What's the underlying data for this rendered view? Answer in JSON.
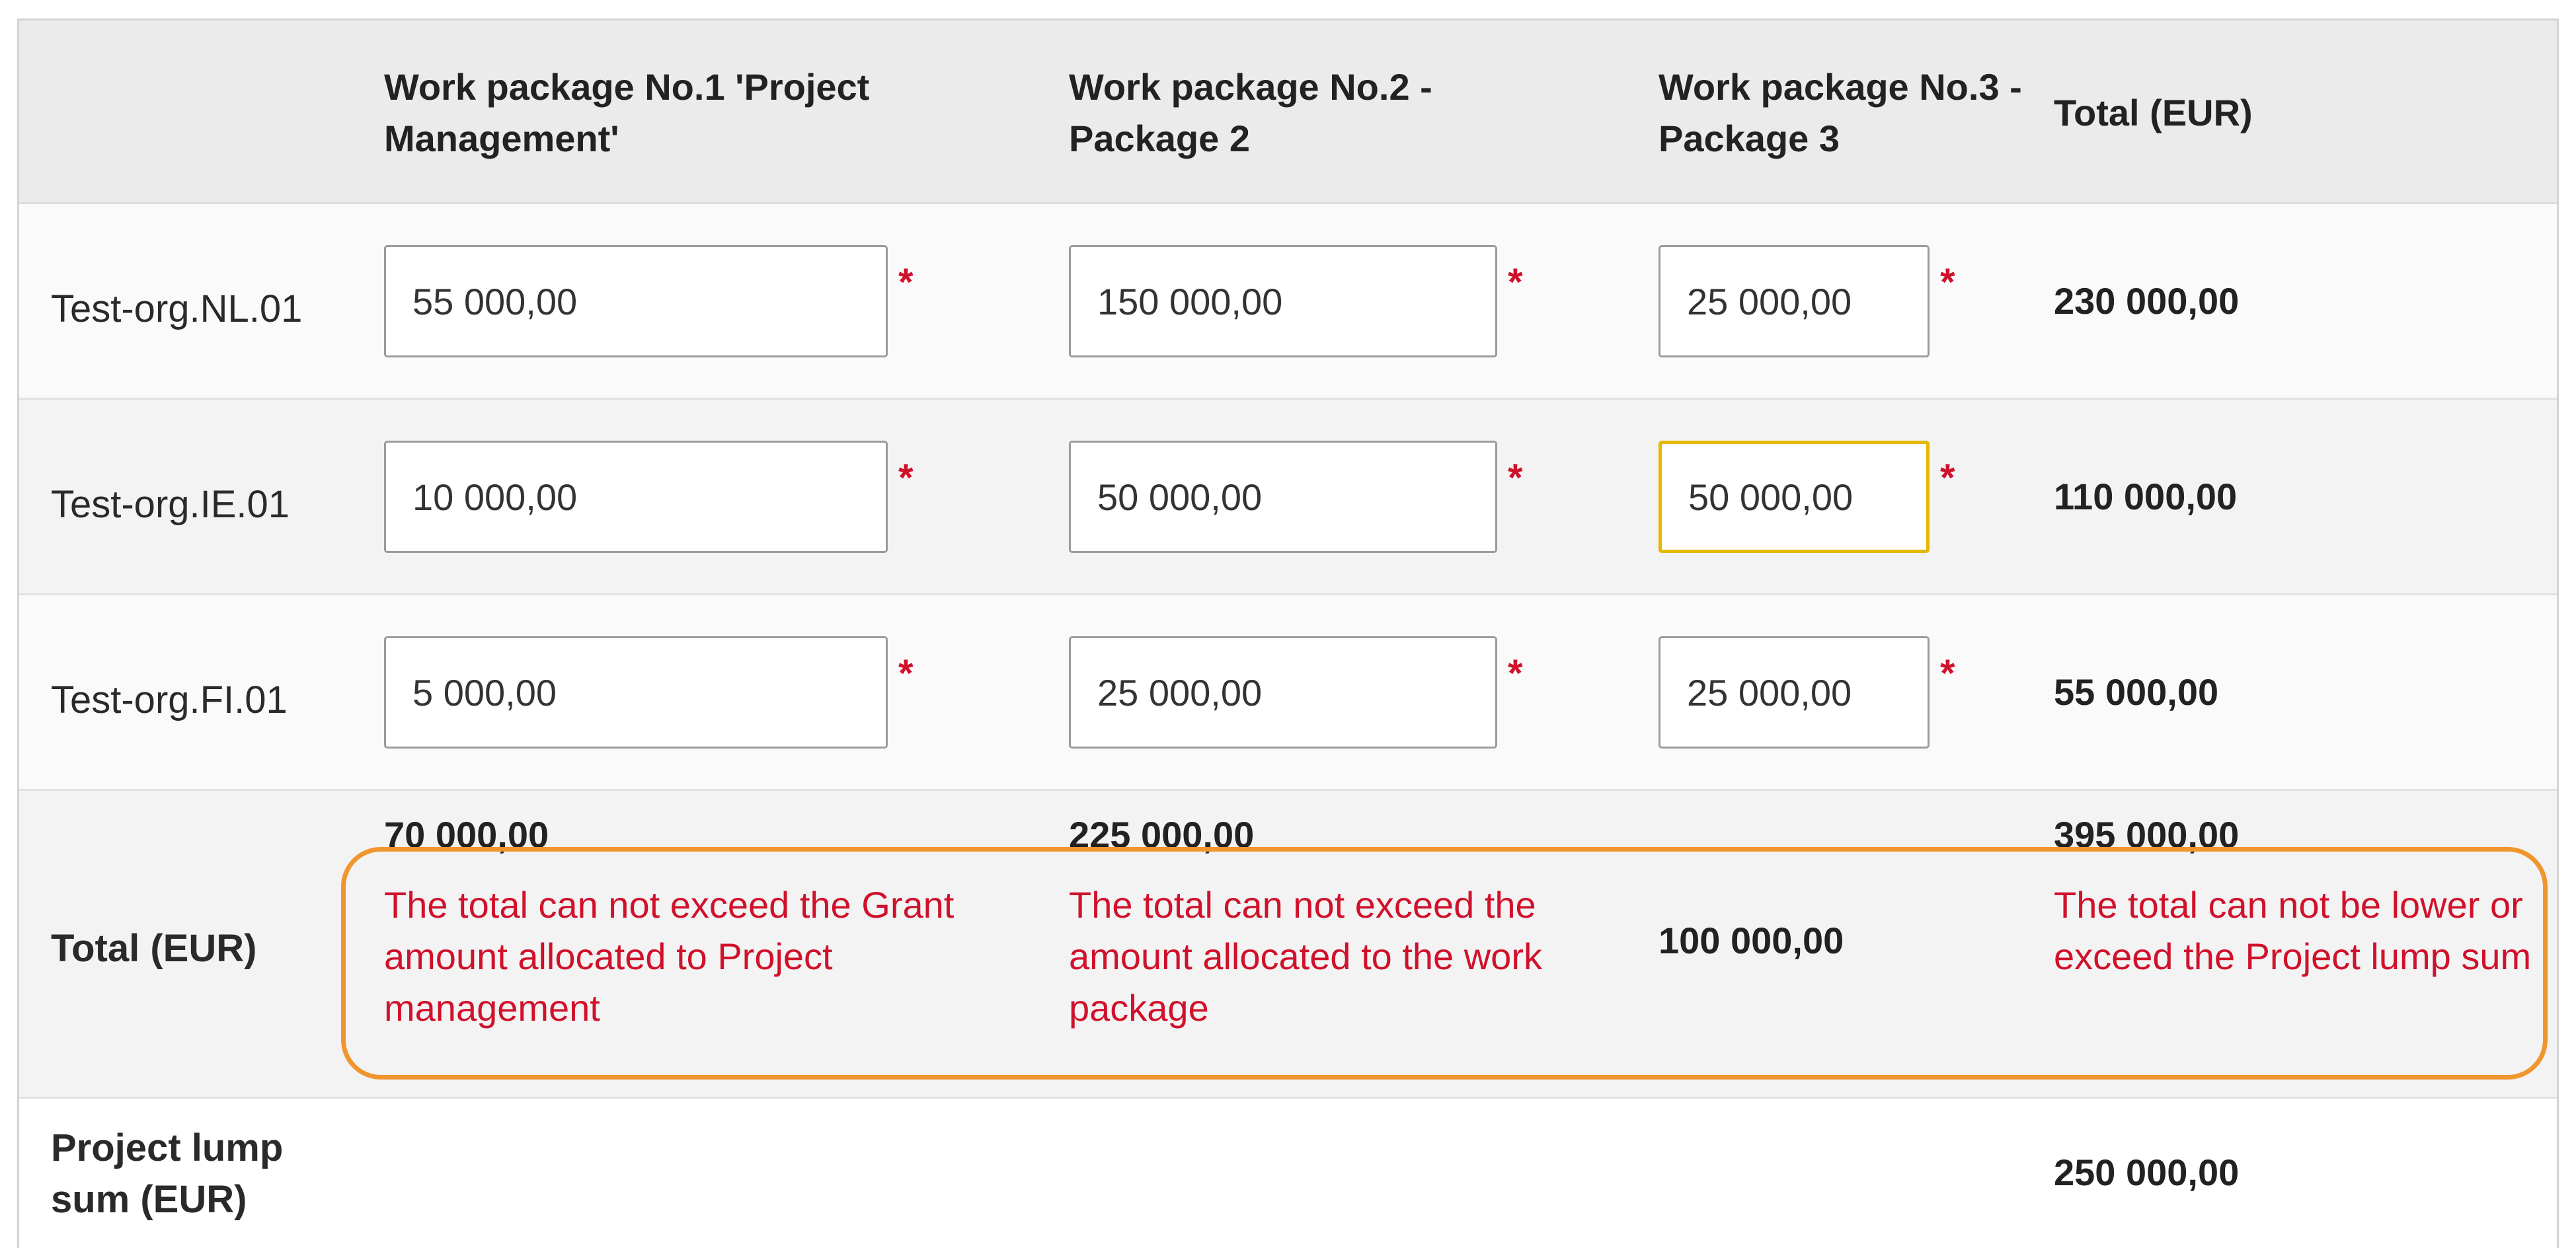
{
  "header": {
    "col1": "",
    "wp1": "Work package No.1 'Project Management'",
    "wp2": "Work package No.2 - Package 2",
    "wp3": "Work package No.3 - Package 3",
    "total": "Total (EUR)"
  },
  "rows": [
    {
      "org": "Test-org.NL.01",
      "wp1": "55 000,00",
      "wp2": "150 000,00",
      "wp3": "25 000,00",
      "total": "230 000,00"
    },
    {
      "org": "Test-org.IE.01",
      "wp1": "10 000,00",
      "wp2": "50 000,00",
      "wp3": "50 000,00",
      "total": "110 000,00"
    },
    {
      "org": "Test-org.FI.01",
      "wp1": "5 000,00",
      "wp2": "25 000,00",
      "wp3": "25 000,00",
      "total": "55 000,00"
    }
  ],
  "required_marker": "*",
  "totals": {
    "label": "Total (EUR)",
    "wp1": "70 000,00",
    "wp2": "225 000,00",
    "wp3": "100 000,00",
    "total": "395 000,00",
    "wp1_error": "The total can not exceed the Grant amount allocated to Project management",
    "wp2_error": "The total can not exceed the amount allocated to the work package",
    "total_error": "The total can not be lower or exceed the Project lump sum"
  },
  "lump_sum": {
    "label": "Project lump sum (EUR)",
    "total": "250 000,00"
  },
  "colors": {
    "error": "#d0112b",
    "focus_border": "#e6b800",
    "highlight": "#f0962e",
    "header_bg": "#ebebeb"
  }
}
